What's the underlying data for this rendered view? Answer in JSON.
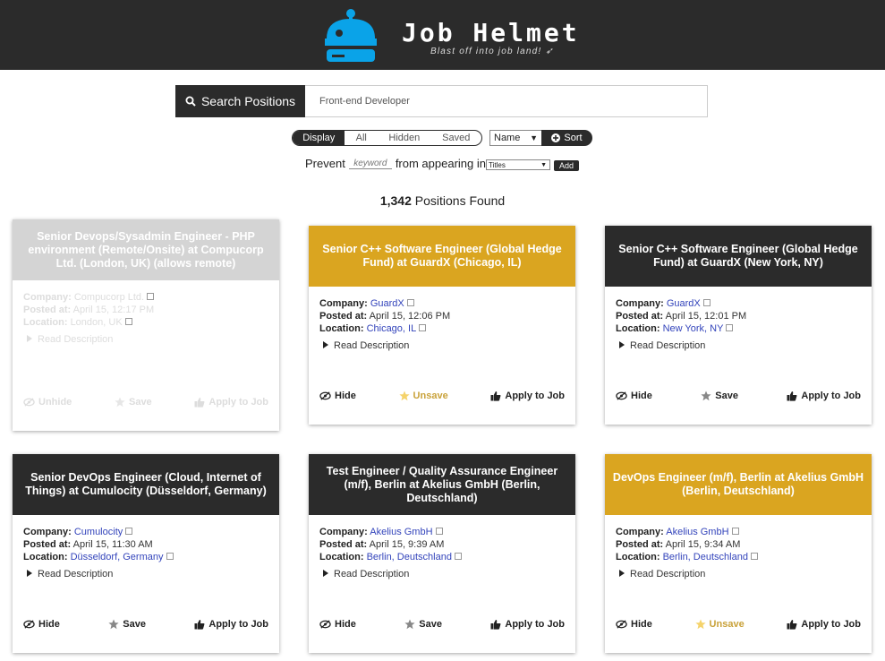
{
  "brand": {
    "title": "Job Helmet",
    "tagline": "Blast off into job land! "
  },
  "search": {
    "button_label": "Search Positions",
    "value": "Front-end Developer"
  },
  "filter": {
    "tabs": [
      "Display",
      "All",
      "Hidden",
      "Saved"
    ],
    "active_tab": "Display",
    "sort_field": "Name",
    "sort_label": "Sort"
  },
  "prevent": {
    "prefix": "Prevent",
    "keyword_placeholder": "keyword",
    "middle": "from appearing in",
    "scope": "Titles",
    "add_label": "Add"
  },
  "results": {
    "count": "1,342",
    "suffix": "Positions Found"
  },
  "labels": {
    "company": "Company:",
    "posted": "Posted at:",
    "location": "Location:",
    "read": "Read Description",
    "hide": "Hide",
    "unhide": "Unhide",
    "save": "Save",
    "unsave": "Unsave",
    "apply": "Apply to Job"
  },
  "colors": {
    "dark": "#2b2b2b",
    "gold": "#daa520",
    "link": "#3344bb"
  },
  "jobs": [
    {
      "title": "Senior Devops/Sysadmin Engineer - PHP environment (Remote/Onsite) at Compucorp Ltd. (London, UK) (allows remote)",
      "company": "Compucorp Ltd.",
      "posted": "April 15, 12:17 PM",
      "location": "London, UK",
      "hide": "Unhide",
      "save": "Save",
      "state": "hidden"
    },
    {
      "title": "Senior C++ Software Engineer (Global Hedge Fund) at GuardX (Chicago, IL)",
      "company": "GuardX",
      "posted": "April 15, 12:06 PM",
      "location": "Chicago, IL",
      "hide": "Hide",
      "save": "Unsave",
      "state": "saved"
    },
    {
      "title": "Senior C++ Software Engineer (Global Hedge Fund) at GuardX (New York, NY)",
      "company": "GuardX",
      "posted": "April 15, 12:01 PM",
      "location": "New York, NY",
      "hide": "Hide",
      "save": "Save",
      "state": "normal"
    },
    {
      "title": "Senior DevOps Engineer (Cloud, Internet of Things) at Cumulocity (Düsseldorf, Germany)",
      "company": "Cumulocity",
      "posted": "April 15, 11:30 AM",
      "location": "Düsseldorf, Germany",
      "hide": "Hide",
      "save": "Save",
      "state": "normal"
    },
    {
      "title": "Test Engineer / Quality Assurance Engineer (m/f), Berlin at Akelius GmbH (Berlin, Deutschland)",
      "company": "Akelius GmbH",
      "posted": "April 15, 9:39 AM",
      "location": "Berlin, Deutschland",
      "hide": "Hide",
      "save": "Save",
      "state": "normal"
    },
    {
      "title": "DevOps Engineer (m/f), Berlin at Akelius GmbH (Berlin, Deutschland)",
      "company": "Akelius GmbH",
      "posted": "April 15, 9:34 AM",
      "location": "Berlin, Deutschland",
      "hide": "Hide",
      "save": "Unsave",
      "state": "saved"
    }
  ]
}
